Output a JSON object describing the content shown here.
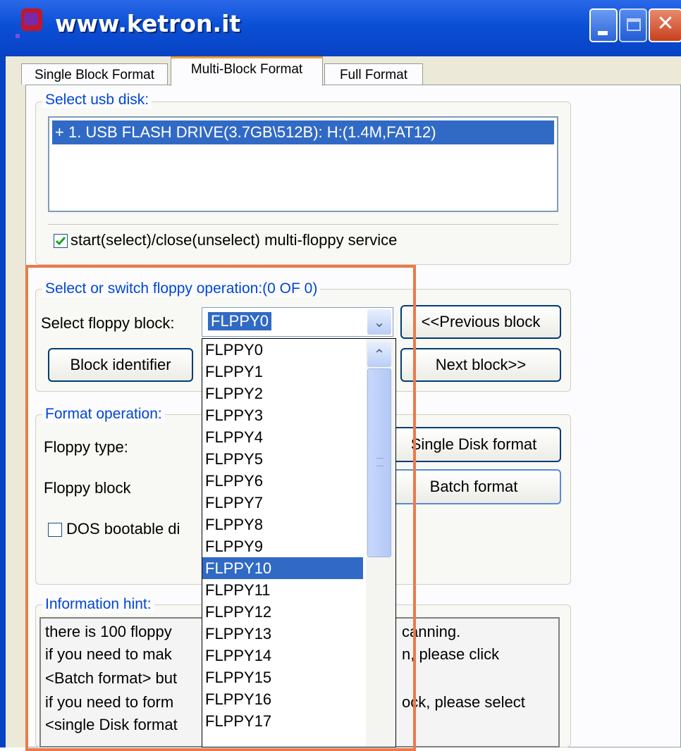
{
  "window": {
    "title": "www.ketron.it"
  },
  "tabs": [
    {
      "label": "Single Block Format"
    },
    {
      "label": "Multi-Block Format"
    },
    {
      "label": "Full Format"
    }
  ],
  "usb_group": {
    "legend": "Select usb disk:",
    "items": [
      "+ 1. USB FLASH DRIVE(3.7GB\\512B): H:(1.4M,FAT12)"
    ],
    "selected_index": 0,
    "service_checkbox": {
      "label": "start(select)/close(unselect) multi-floppy service",
      "checked": true
    }
  },
  "floppy_group": {
    "legend": "Select or switch floppy operation:(0 OF 0)",
    "select_label": "Select floppy block:",
    "selected_value": "FLPPY0",
    "prev_button": "<<Previous block",
    "next_button": "Next block>>",
    "block_id_button": "Block identifier",
    "dropdown_options": [
      "FLPPY0",
      "FLPPY1",
      "FLPPY2",
      "FLPPY3",
      "FLPPY4",
      "FLPPY5",
      "FLPPY6",
      "FLPPY7",
      "FLPPY8",
      "FLPPY9",
      "FLPPY10",
      "FLPPY11",
      "FLPPY12",
      "FLPPY13",
      "FLPPY14",
      "FLPPY15",
      "FLPPY16",
      "FLPPY17"
    ],
    "highlighted_option": "FLPPY10"
  },
  "format_group": {
    "legend": "Format operation:",
    "floppy_type_label": "Floppy type:",
    "floppy_block_label": "Floppy block",
    "dos_checkbox": {
      "label": "DOS bootable di",
      "checked": false
    },
    "single_button": "Single Disk format",
    "batch_button": "Batch format"
  },
  "hint_group": {
    "legend": "Information hint:",
    "lines_left": [
      "there is 100 floppy",
      " if you need to mak",
      "<Batch format> but",
      " if you need to form",
      "<single Disk format"
    ],
    "lines_right": [
      "canning.",
      "n, please click",
      "",
      "ock, please select",
      ""
    ]
  },
  "colors": {
    "titlebar": "#0a4fd6",
    "selection": "#316ac5",
    "annotation": "#ea7a4c"
  }
}
